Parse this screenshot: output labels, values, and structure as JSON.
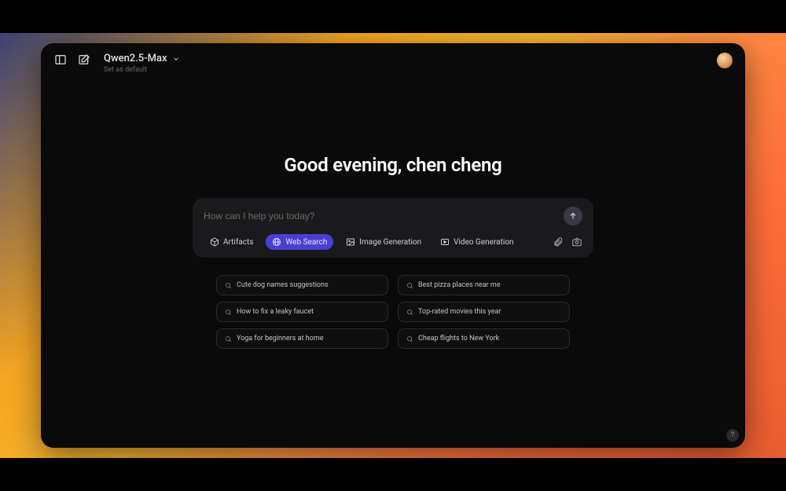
{
  "header": {
    "model_name": "Qwen2.5-Max",
    "set_default": "Set as default"
  },
  "greeting": "Good evening, chen cheng",
  "input": {
    "placeholder": "How can I help you today?"
  },
  "modes": {
    "artifacts": "Artifacts",
    "web_search": "Web Search",
    "image_gen": "Image Generation",
    "video_gen": "Video Generation"
  },
  "suggestions": [
    "Cute dog names suggestions",
    "Best pizza places near me",
    "How to fix a leaky faucet",
    "Top-rated movies this year",
    "Yoga for beginners at home",
    "Cheap flights to New York"
  ],
  "help_label": "?"
}
